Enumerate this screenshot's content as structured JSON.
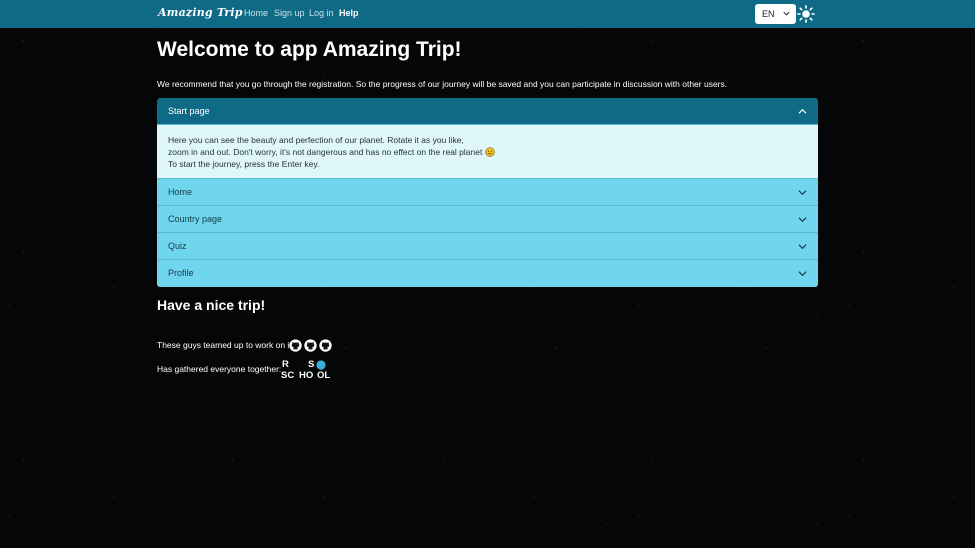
{
  "navbar": {
    "brand": "Amazing Trip",
    "links": [
      "Home",
      "Sign up",
      "Log in",
      "Help"
    ],
    "active_link": "Help",
    "language": "EN",
    "language_icon": "chevron-down-icon",
    "theme_icon": "sun-icon",
    "bg_color": "#0f6a86"
  },
  "main": {
    "title": "Welcome to app Amazing Trip!",
    "intro": "We recommend that you go through the registration. So the progress of our journey will be saved and you can participate in discussion with other users.",
    "accordion": [
      {
        "label": "Start page",
        "expanded": true,
        "body_lines": [
          "Here you can see the beauty and perfection of our planet. Rotate it as you like,",
          "zoom in and out. Don't worry, it's not dangerous and has no effect on the real planet",
          "To start the journey, press the Enter key."
        ]
      },
      {
        "label": "Home",
        "expanded": false
      },
      {
        "label": "Country page",
        "expanded": false
      },
      {
        "label": "Quiz",
        "expanded": false
      },
      {
        "label": "Profile",
        "expanded": false
      }
    ],
    "goodbye": "Have a nice trip!",
    "team_text": "These guys teamed up to work on it",
    "team_icons": [
      "github-icon",
      "github-icon",
      "github-icon"
    ],
    "school_text": "Has gathered everyone together:",
    "school_logo_text": [
      "R",
      "S",
      "SC",
      "HO",
      "OL"
    ]
  }
}
